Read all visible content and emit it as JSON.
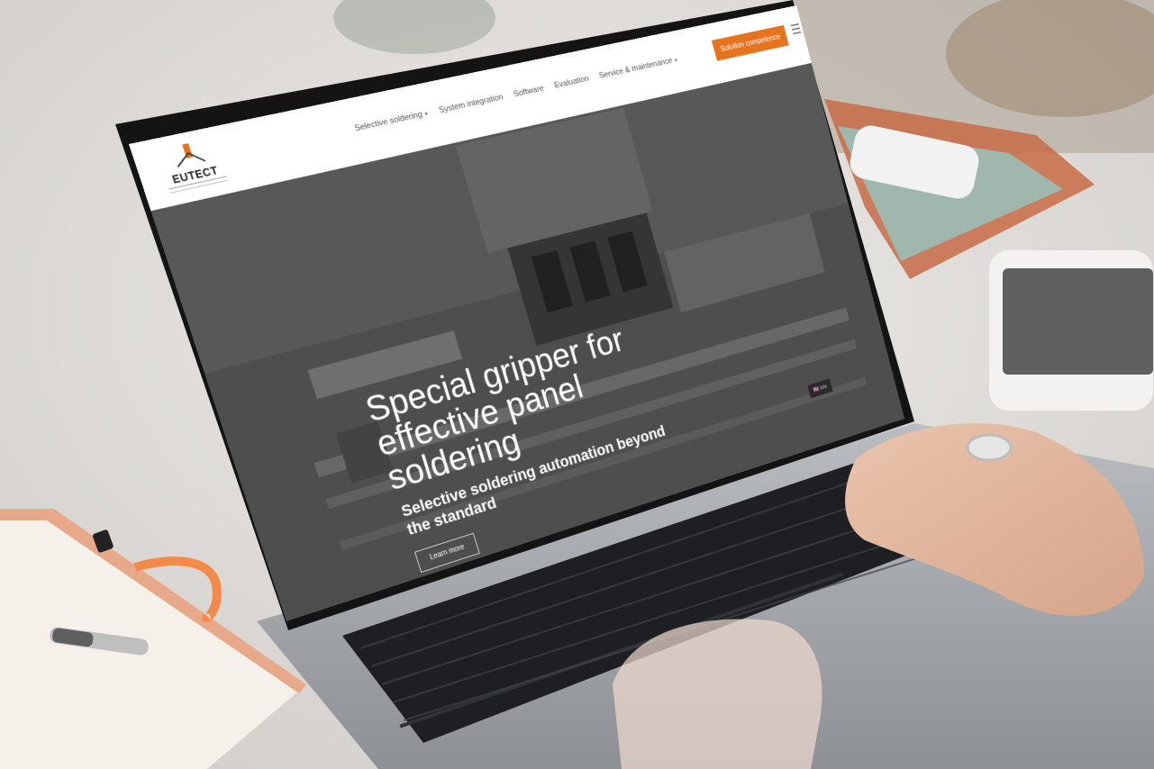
{
  "site": {
    "logo_text": "EUTECT",
    "nav": [
      {
        "label": "Selective soldering",
        "has_dropdown": true
      },
      {
        "label": "System integration",
        "has_dropdown": false
      },
      {
        "label": "Software",
        "has_dropdown": false
      },
      {
        "label": "Evaluation",
        "has_dropdown": false
      },
      {
        "label": "Service & maintenance",
        "has_dropdown": true
      }
    ],
    "cta_label": "Solution competence",
    "menu_icon": "hamburger-menu-icon",
    "accent_color": "#e8731f"
  },
  "hero": {
    "title": "Special gripper for effective panel soldering",
    "subtitle": "Selective soldering automation beyond the standard",
    "button_label": "Learn more"
  },
  "language": {
    "code": "EN",
    "icon": "uk-flag-icon"
  }
}
